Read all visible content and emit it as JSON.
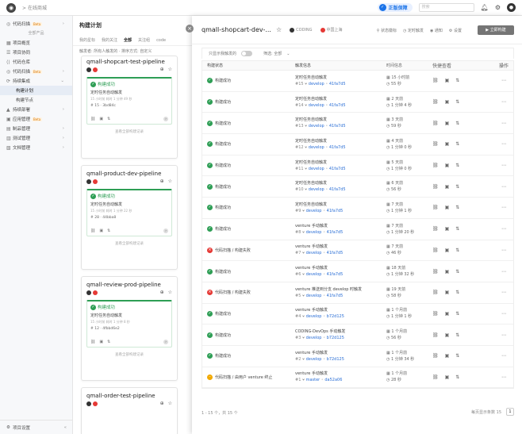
{
  "topbar": {
    "project": "在线商城",
    "vip": "正版保障",
    "search_placeholder": "搜索"
  },
  "sidebar": {
    "items_top": [
      {
        "label": "代码扫描",
        "beta": "Beta",
        "arrow": true
      }
    ],
    "section": "全部产品",
    "items": [
      {
        "label": "项目概览"
      },
      {
        "label": "项目协同"
      },
      {
        "label": "代码仓库"
      },
      {
        "label": "代码扫描",
        "beta": "Beta",
        "arrow": true
      },
      {
        "label": "持续集成",
        "arrow": "down"
      }
    ],
    "subitems": [
      {
        "label": "构建计划",
        "active": true
      },
      {
        "label": "构建节点"
      }
    ],
    "items2": [
      {
        "label": "持续部署",
        "arrow": true
      },
      {
        "label": "应用管理",
        "beta": "Beta"
      },
      {
        "label": "制品管理",
        "arrow": true
      },
      {
        "label": "测试管理",
        "arrow": true
      },
      {
        "label": "文档管理",
        "arrow": true
      }
    ],
    "bottom": "项目设置"
  },
  "mid": {
    "title": "构建计划",
    "tabs": [
      "我的星标",
      "我的关注",
      "全部",
      "关注组",
      "code"
    ],
    "filter": "触发者: 所有人触发的 · 排序方式: 自定义",
    "cards": [
      {
        "name": "qmall-shopcart-test-pipeline",
        "status": "构建成功",
        "trigger": "定时任务自动触发",
        "meta": "15 小时前 耗时 1 分钟 49 秒",
        "num": "# 15 · 3bd84c",
        "more": "查看全部构建记录"
      },
      {
        "name": "qmall-product-dev-pipeline",
        "status": "构建成功",
        "trigger": "定时任务自动触发",
        "meta": "15 小时前 耗时 1 分钟 22 秒",
        "num": "# 28 · 44bba8",
        "more": "查看全部构建记录"
      },
      {
        "name": "qmall-review-prod-pipeline",
        "status": "构建成功",
        "trigger": "定时任务自动触发",
        "meta": "15 小时前 耗时 1 分钟 8 秒",
        "num": "# 12 · 4fbbd6e2",
        "more": "查看全部构建记录"
      },
      {
        "name": "qmall-order-test-pipeline"
      }
    ]
  },
  "overlay": {
    "title": "qmall-shopcart-dev-...",
    "org": "CODING",
    "region": "中国上海",
    "links": [
      "状态徽标",
      "定时触发",
      "通知",
      "设置"
    ],
    "run_button": "立即构建",
    "filter_label": "只显示我触发的",
    "filter_select": "筛选: 全部",
    "columns": [
      "构建状态",
      "触发信息",
      "时间信息",
      "快捷查看",
      "操作"
    ],
    "rows": [
      {
        "status": "构建成功",
        "kind": "ok",
        "trigger": "定时任务自动触发",
        "num": "#15",
        "branch": "develop",
        "commit": "41fa7d5",
        "time": "15 小时前",
        "dur": "55 秒"
      },
      {
        "status": "构建成功",
        "kind": "ok",
        "trigger": "定时任务自动触发",
        "num": "#14",
        "branch": "develop",
        "commit": "41fa7d5",
        "time": "2 天前",
        "dur": "1 分钟 4 秒"
      },
      {
        "status": "构建成功",
        "kind": "ok",
        "trigger": "定时任务自动触发",
        "num": "#13",
        "branch": "develop",
        "commit": "41fa7d5",
        "time": "3 天前",
        "dur": "59 秒"
      },
      {
        "status": "构建成功",
        "kind": "ok",
        "trigger": "定时任务自动触发",
        "num": "#12",
        "branch": "develop",
        "commit": "41fa7d5",
        "time": "4 天前",
        "dur": "1 分钟 0 秒"
      },
      {
        "status": "构建成功",
        "kind": "ok",
        "trigger": "定时任务自动触发",
        "num": "#11",
        "branch": "develop",
        "commit": "41fa7d5",
        "time": "5 天前",
        "dur": "1 分钟 0 秒"
      },
      {
        "status": "构建成功",
        "kind": "ok",
        "trigger": "定时任务自动触发",
        "num": "#10",
        "branch": "develop",
        "commit": "41fa7d5",
        "time": "6 天前",
        "dur": "56 秒"
      },
      {
        "status": "构建成功",
        "kind": "ok",
        "trigger": "定时任务自动触发",
        "num": "#9",
        "branch": "develop",
        "commit": "41fa7d5",
        "time": "7 天前",
        "dur": "1 分钟 1 秒"
      },
      {
        "status": "构建成功",
        "kind": "ok",
        "trigger": "venture 手动触发",
        "num": "#8",
        "branch": "develop",
        "commit": "41fa7d5",
        "time": "7 天前",
        "dur": "1 分钟 20 秒"
      },
      {
        "status": "代码扫描 / 构建失败",
        "kind": "fail",
        "trigger": "venture 手动触发",
        "num": "#7",
        "branch": "develop",
        "commit": "41fa7d5",
        "time": "7 天前",
        "dur": "46 秒"
      },
      {
        "status": "构建成功",
        "kind": "ok",
        "trigger": "venture 手动触发",
        "num": "#6",
        "branch": "develop",
        "commit": "41fa7d5",
        "time": "18 天前",
        "dur": "1 分钟 32 秒"
      },
      {
        "status": "代码扫描 / 构建失败",
        "kind": "fail",
        "trigger": "venture 推送到分支 develop 时触发",
        "num": "#5",
        "branch": "develop",
        "commit": "41fa7d5",
        "time": "19 天前",
        "dur": "58 秒"
      },
      {
        "status": "构建成功",
        "kind": "ok",
        "trigger": "venture 手动触发",
        "num": "#4",
        "branch": "develop",
        "commit": "b72d125",
        "time": "1 个月前",
        "dur": "1 分钟 1 秒"
      },
      {
        "status": "构建成功",
        "kind": "ok",
        "trigger": "CODING-DevOps 手动触发",
        "num": "#3",
        "branch": "develop",
        "commit": "b72d125",
        "time": "1 个月前",
        "dur": "56 秒"
      },
      {
        "status": "构建成功",
        "kind": "ok",
        "trigger": "venture 手动触发",
        "num": "#2",
        "branch": "develop",
        "commit": "b72d125",
        "time": "1 个月前",
        "dur": "1 分钟 34 秒"
      },
      {
        "status": "代码扫描 / 由用户 venture 终止",
        "kind": "warn",
        "trigger": "venture 手动触发",
        "num": "#1",
        "branch": "master",
        "commit": "da52a06",
        "time": "1 个月前",
        "dur": "28 秒"
      }
    ],
    "pager_text": "1 - 15 个，共 15 个",
    "page_size": "每页显示条数 15",
    "page": "1"
  }
}
